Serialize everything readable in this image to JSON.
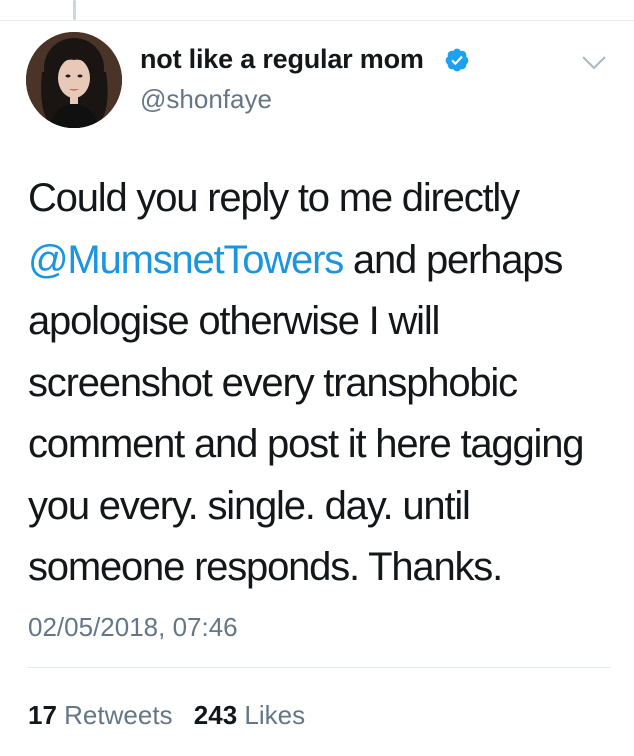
{
  "author": {
    "display_name": "not like a regular mom",
    "handle": "@shonfaye",
    "verified": true
  },
  "tweet": {
    "line1": "Could you reply to me directly",
    "mention": "@MumsnetTowers",
    "line2_rest": " and perhaps",
    "line3": "apologise otherwise I will",
    "line4": "screenshot every transphobic",
    "line5": "comment and post it here tagging",
    "line6": "you every. single. day. until",
    "line7": "someone responds. Thanks."
  },
  "timestamp": "02/05/2018, 07:46",
  "stats": {
    "retweets_count": "17",
    "retweets_label": "Retweets",
    "likes_count": "243",
    "likes_label": "Likes"
  },
  "colors": {
    "link": "#1b95e0",
    "verified": "#1da1f2",
    "secondary_text": "#657786"
  }
}
